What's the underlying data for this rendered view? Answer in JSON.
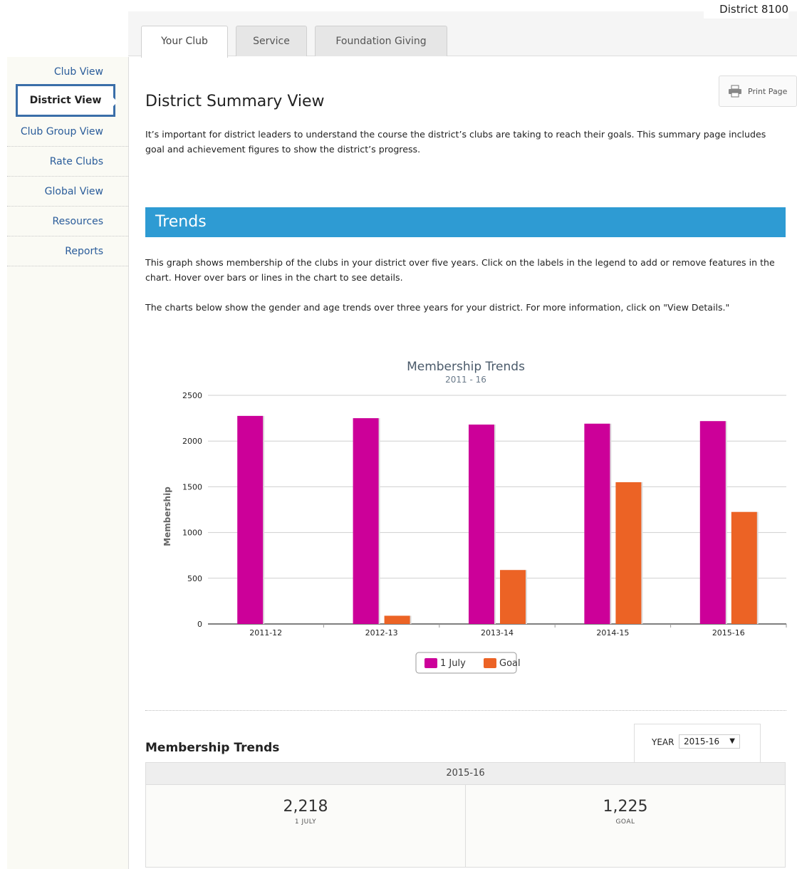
{
  "district_label": "District 8100",
  "tabs": [
    {
      "label": "Your Club"
    },
    {
      "label": "Service"
    },
    {
      "label": "Foundation Giving"
    }
  ],
  "sidebar": {
    "items": [
      {
        "label": "Club View"
      },
      {
        "label": "District View"
      },
      {
        "label": "Club Group View"
      },
      {
        "label": "Rate Clubs"
      },
      {
        "label": "Global View"
      },
      {
        "label": "Resources"
      },
      {
        "label": "Reports"
      }
    ]
  },
  "page": {
    "title": "District Summary View",
    "print_label": "Print Page",
    "intro": "It’s important for district leaders to understand the course the district’s clubs are taking to reach their goals. This summary page includes goal and achievement figures to show the district’s progress.",
    "trends_heading": "Trends",
    "trends_para1": "This graph shows membership of the clubs in your district over five years. Click on the labels in the legend to add or remove features in the chart. Hover over bars or lines in the chart to see details.",
    "trends_para2": "The charts below show the gender and age trends over three years for your district. For more information, click on \"View Details.\""
  },
  "chart_data": {
    "type": "bar",
    "title": "Membership Trends",
    "subtitle": "2011 - 16",
    "xlabel": "",
    "ylabel": "Membership",
    "ylim": [
      0,
      2500
    ],
    "yticks": [
      0,
      500,
      1000,
      1500,
      2000,
      2500
    ],
    "categories": [
      "2011-12",
      "2012-13",
      "2013-14",
      "2014-15",
      "2015-16"
    ],
    "series": [
      {
        "name": "1 July",
        "color": "#cc0099",
        "values": [
          2275,
          2250,
          2180,
          2190,
          2218
        ]
      },
      {
        "name": "Goal",
        "color": "#ec6325",
        "values": [
          0,
          90,
          590,
          1550,
          1225
        ]
      }
    ],
    "legend_position": "bottom-center",
    "grid": true
  },
  "membership_table": {
    "title": "Membership Trends",
    "year_label": "YEAR",
    "year_value": "2015-16",
    "header": "2015-16",
    "cells": [
      {
        "value": "2,218",
        "label": "1 JULY"
      },
      {
        "value": "1,225",
        "label": "GOAL"
      }
    ]
  }
}
